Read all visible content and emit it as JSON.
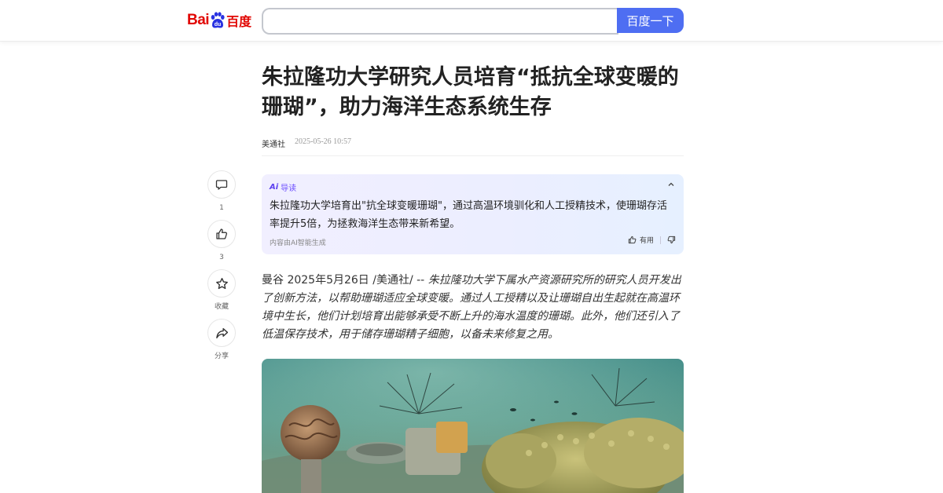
{
  "header": {
    "logo_bai": "Bai",
    "logo_du": "du",
    "logo_cn": "百度",
    "search_placeholder": "",
    "search_value": "",
    "search_button": "百度一下"
  },
  "article": {
    "title": "朱拉隆功大学研究人员培育“抵抗全球变暖的珊瑚”，助力海洋生态系统生存",
    "source": "美通社",
    "timestamp": "2025-05-26 10:57",
    "lead_plain": "曼谷 2025年5月26日 /美通社/ -- ",
    "lead_italic": "朱拉隆功大学下属水产资源研究所的研究人员开发出了创新方法，以帮助珊瑚适应全球变暖。通过人工授精以及让珊瑚自出生起就在高温环境中生长，他们计划培育出能够承受不断上升的海水温度的珊瑚。此外，他们还引入了低温保存技术，用于储存珊瑚精子细胞，以备未来修复之用。"
  },
  "actions": {
    "comment": {
      "icon": "comment-icon",
      "count": "1"
    },
    "like": {
      "icon": "thumbs-up-icon",
      "count": "3"
    },
    "favorite": {
      "icon": "star-icon",
      "label": "收藏"
    },
    "share": {
      "icon": "share-icon",
      "label": "分享"
    }
  },
  "ai_summary": {
    "badge": "Ai",
    "heading": "导读",
    "text": "朱拉隆功大学培育出\"抗全球变暖珊瑚\"，通过高温环境驯化和人工授精技术，使珊瑚存活率提升5倍，为拯救海洋生态带来新希望。",
    "footer": "内容由AI智能生成",
    "useful_label": "有用"
  },
  "colors": {
    "brand_red": "#e10602",
    "brand_blue": "#2932e1",
    "search_button": "#4e6ef2",
    "ai_accent": "#6a4cff"
  }
}
